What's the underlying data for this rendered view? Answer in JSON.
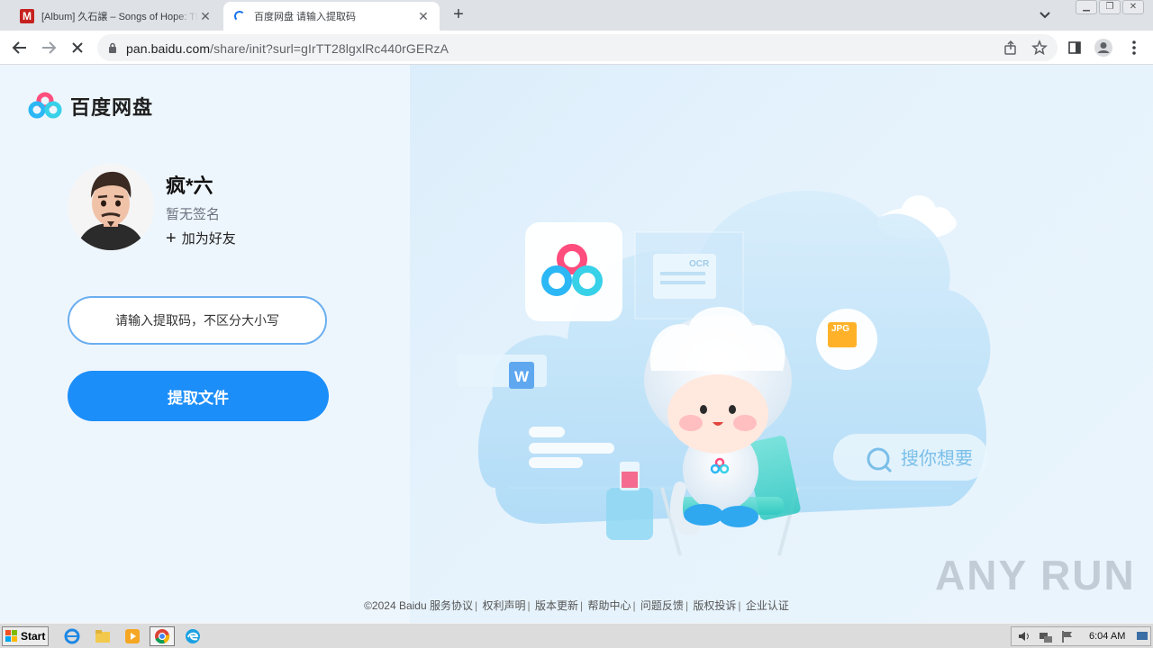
{
  "browser": {
    "tabs": [
      {
        "title": "[Album] 久石譲 – Songs of Hope: The Essential Piano Collection",
        "icon": "mega-favicon",
        "active": false
      },
      {
        "title": "百度网盘 请输入提取码",
        "icon": "loading-spinner",
        "active": true
      }
    ],
    "url_host": "pan.baidu.com",
    "url_path": "/share/init?surl=gIrTT28lgxlRc440rGERzA"
  },
  "page": {
    "logo_text": "百度网盘",
    "user": {
      "name": "疯*六",
      "signature": "暂无签名",
      "add_friend": "加为好友"
    },
    "code_input": {
      "placeholder": "请输入提取码，不区分大小写",
      "value": ""
    },
    "submit_label": "提取文件",
    "illustration": {
      "ocr_label": "OCR",
      "jpg_label": "JPG",
      "word_label": "W",
      "search_label": "搜你想要"
    },
    "footer": {
      "copyright": "©2024 Baidu",
      "links": [
        "服务协议",
        "权利声明",
        "版本更新",
        "帮助中心",
        "问题反馈",
        "版权投诉",
        "企业认证"
      ]
    }
  },
  "watermark": "ANY RUN",
  "taskbar": {
    "start_label": "Start",
    "apps": [
      "ie-icon",
      "explorer-icon",
      "media-player-icon",
      "chrome-icon",
      "edge-icon"
    ],
    "clock": "6:04 AM"
  },
  "colors": {
    "primary": "#1c8ef9",
    "input_border": "#6aaef0",
    "page_bg": "#eef6fd"
  }
}
